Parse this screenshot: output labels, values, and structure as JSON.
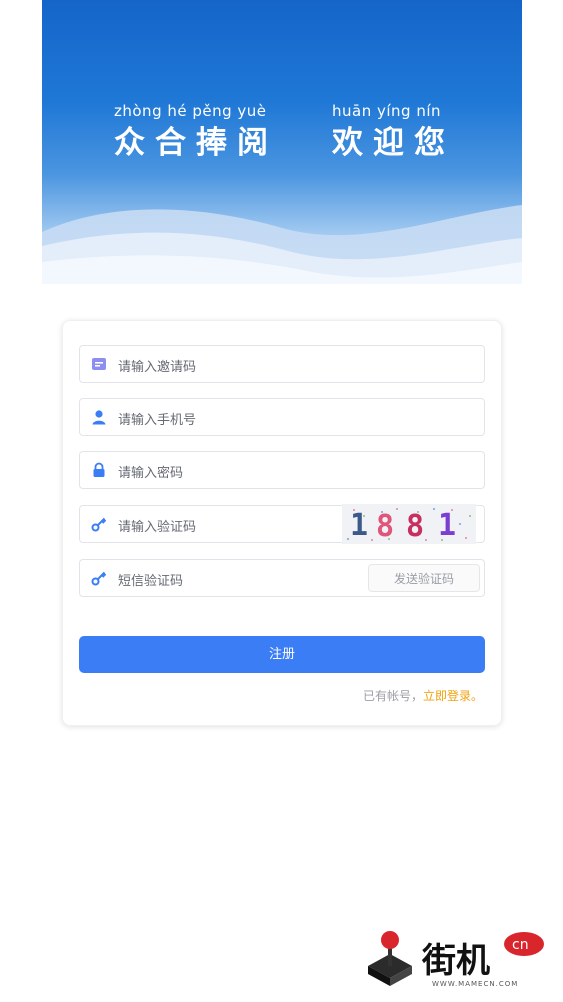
{
  "header": {
    "pinyin_1": "zhòng  hé  pěng  yuè",
    "chars_1": "众合捧阅",
    "pinyin_2": "huān  yíng  nín",
    "chars_2": "欢迎您"
  },
  "form": {
    "invite_placeholder": "请输入邀请码",
    "phone_placeholder": "请输入手机号",
    "password_placeholder": "请输入密码",
    "captcha_placeholder": "请输入验证码",
    "captcha_text": "1881",
    "sms_placeholder": "短信验证码",
    "sms_button": "发送验证码",
    "register_button": "注册",
    "has_account": "已有帐号，",
    "login_link": "立即登录。"
  },
  "watermark": {
    "brand": "街机",
    "badge": "cn",
    "url": "WWW.MAMECN.COM"
  },
  "colors": {
    "primary": "#3a7df5",
    "link": "#f2a20f",
    "header_top": "#1565c8"
  }
}
